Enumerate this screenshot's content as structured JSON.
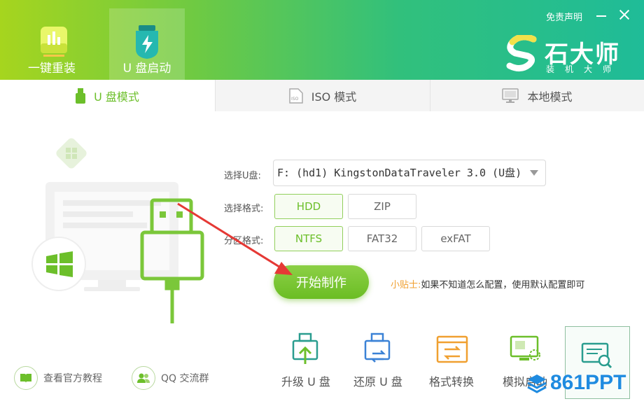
{
  "header": {
    "nav": [
      {
        "label": "一键重装",
        "icon": "bar-chart-icon"
      },
      {
        "label": "U 盘启动",
        "icon": "usb-lightning-icon"
      }
    ],
    "disclaimer": "免责声明",
    "brand": {
      "name": "石大师",
      "sub": "装机大师",
      "logo": "s-logo-icon"
    }
  },
  "tabs": [
    {
      "label": "U 盘模式",
      "icon": "usb-drive-icon"
    },
    {
      "label": "ISO 模式",
      "icon": "iso-file-icon"
    },
    {
      "label": "本地模式",
      "icon": "monitor-icon"
    }
  ],
  "form": {
    "usb_label": "选择U盘:",
    "usb_value": "F: (hd1) KingstonDataTraveler 3.0 (U盘)",
    "format_label": "选择格式:",
    "formats": [
      "HDD",
      "ZIP"
    ],
    "partition_label": "分区格式:",
    "partitions": [
      "NTFS",
      "FAT32",
      "exFAT"
    ]
  },
  "start_button": "开始制作",
  "tip": {
    "title": "小贴士:",
    "text": "如果不知道怎么配置，使用默认配置即可"
  },
  "tools": [
    {
      "label": "升级 U 盘",
      "icon": "usb-upgrade-icon"
    },
    {
      "label": "还原 U 盘",
      "icon": "usb-restore-icon"
    },
    {
      "label": "格式转换",
      "icon": "format-convert-icon"
    },
    {
      "label": "模拟启动",
      "icon": "simulate-boot-icon"
    },
    {
      "label": "",
      "icon": "shortcut-query-icon"
    }
  ],
  "bottom_links": [
    {
      "label": "查看官方教程",
      "icon": "book-icon"
    },
    {
      "label": "QQ 交流群",
      "icon": "group-icon"
    }
  ],
  "watermark": "861PPT",
  "colors": {
    "accent": "#6cbf2a",
    "header_start": "#a6d51e",
    "header_end": "#1fbc98",
    "tip": "#f0a030",
    "arrow": "#e53935"
  }
}
